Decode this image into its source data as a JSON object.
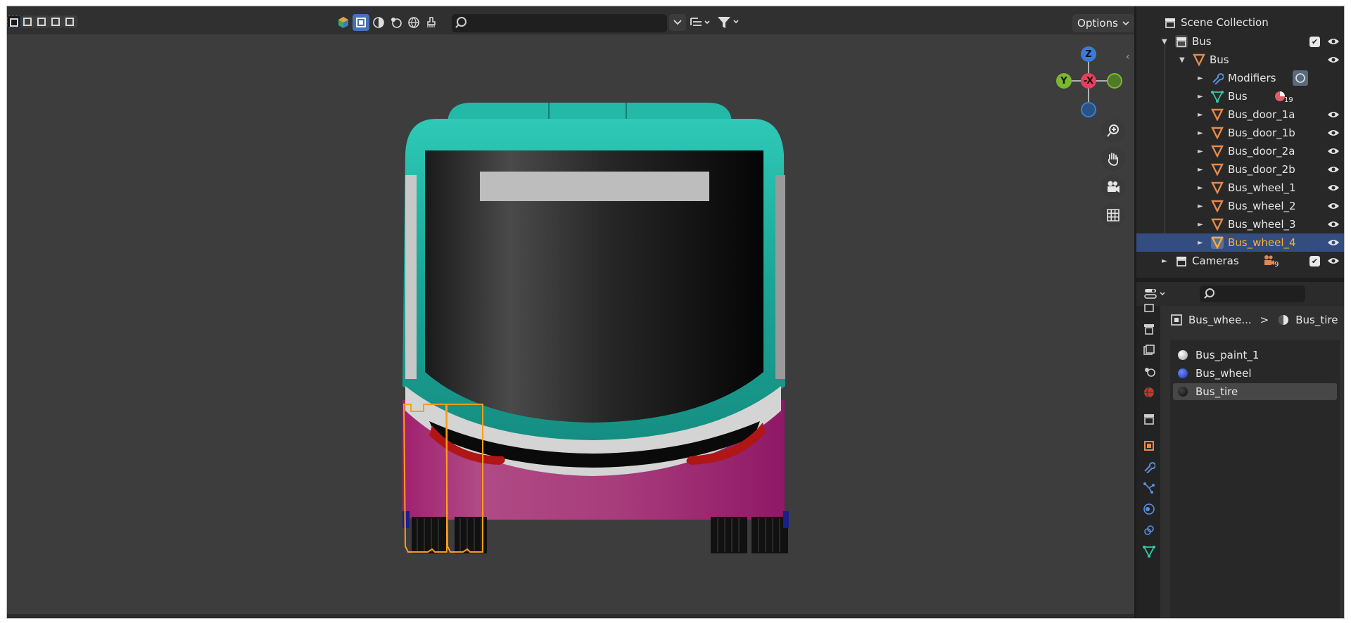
{
  "header": {
    "search_placeholder": "",
    "options_label": "Options"
  },
  "gizmo": {
    "z_label": "Z",
    "y_label": "Y",
    "x_label": "-X"
  },
  "outliner": {
    "scene_collection": "Scene Collection",
    "items": [
      {
        "label": "Bus",
        "type": "collection",
        "badge": ""
      },
      {
        "label": "Bus",
        "type": "object",
        "badge": ""
      },
      {
        "label": "Modifiers",
        "type": "modifiers",
        "badge": ""
      },
      {
        "label": "Bus",
        "type": "mesh",
        "badge": "19"
      },
      {
        "label": "Bus_door_1a",
        "type": "object",
        "badge": ""
      },
      {
        "label": "Bus_door_1b",
        "type": "object",
        "badge": ""
      },
      {
        "label": "Bus_door_2a",
        "type": "object",
        "badge": ""
      },
      {
        "label": "Bus_door_2b",
        "type": "object",
        "badge": ""
      },
      {
        "label": "Bus_wheel_1",
        "type": "object",
        "badge": ""
      },
      {
        "label": "Bus_wheel_2",
        "type": "object",
        "badge": ""
      },
      {
        "label": "Bus_wheel_3",
        "type": "object",
        "badge": ""
      },
      {
        "label": "Bus_wheel_4",
        "type": "object",
        "badge": "",
        "selected": true
      },
      {
        "label": "Cameras",
        "type": "collection",
        "badge": "9"
      }
    ]
  },
  "properties": {
    "search_placeholder": "",
    "breadcrumb_object": "Bus_whee...",
    "breadcrumb_separator": ">",
    "breadcrumb_material": "Bus_tire",
    "materials": [
      {
        "name": "Bus_paint_1",
        "color": "#f2f2f2"
      },
      {
        "name": "Bus_wheel",
        "color": "#1f3fd6"
      },
      {
        "name": "Bus_tire",
        "color": "#151515",
        "selected": true
      }
    ]
  },
  "colors": {
    "viewport_bg": "#3d3d3d",
    "selection_highlight": "#334d80",
    "selected_text": "#ffb029",
    "object_icon": "#e6894b",
    "bus_teal": "#1fb5a4",
    "bus_magenta": "#b02a7e"
  }
}
